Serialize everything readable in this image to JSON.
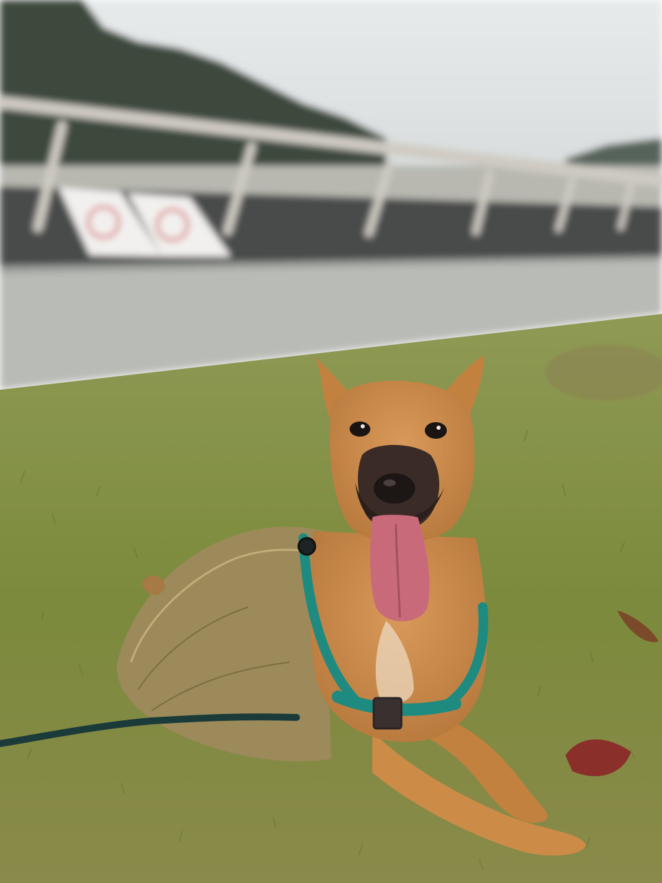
{
  "scene": {
    "subject": "dog",
    "colors": {
      "sky": "#dfe3e3",
      "trees": "#3d4a3e",
      "railing": "#cfcbc2",
      "barrier": "#4a4b4c",
      "path": "#b9bbb6",
      "grass": "#7e8a3c",
      "dry_grass": "#9c8a5a",
      "fur": "#c98a4a",
      "muzzle": "#2b2220",
      "tongue": "#c96a7a",
      "harness": "#1f8a80",
      "leash": "#1b3a3a",
      "leaf": "#8a2f2a"
    }
  }
}
